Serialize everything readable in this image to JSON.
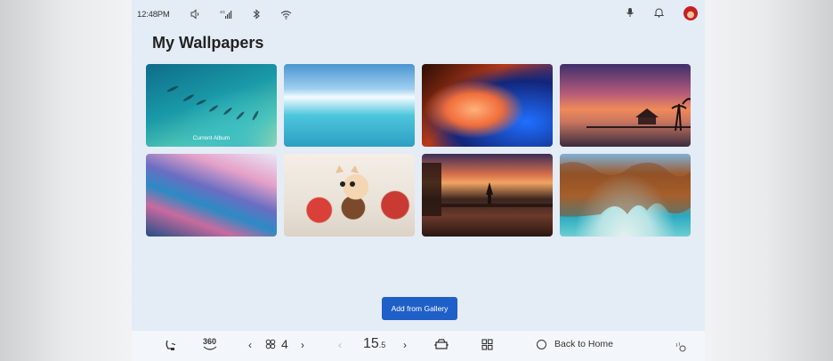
{
  "status": {
    "time": "12:48PM",
    "icons": [
      "volume-icon",
      "signal-icon",
      "bluetooth-icon",
      "wifi-icon"
    ],
    "right_icons": [
      "microphone-icon",
      "bell-icon",
      "avatar"
    ]
  },
  "page": {
    "title": "My Wallpapers"
  },
  "wallpapers": [
    {
      "name": "aerial-boats-lagoon",
      "caption": "Current Album"
    },
    {
      "name": "ocean-wave-horizon",
      "caption": ""
    },
    {
      "name": "abstract-orange-blue-swirl",
      "caption": ""
    },
    {
      "name": "sunset-overwater-hut",
      "caption": ""
    },
    {
      "name": "abstract-pink-blue-waves",
      "caption": ""
    },
    {
      "name": "kitten-in-flower-pot",
      "caption": ""
    },
    {
      "name": "pagoda-sunset-deck",
      "caption": ""
    },
    {
      "name": "sea-cave-beach",
      "caption": ""
    }
  ],
  "actions": {
    "add_from_gallery": "Add from Gallery"
  },
  "dock": {
    "view_360": "360",
    "fan_level": "4",
    "temperature_main": "15",
    "temperature_decimal": ".5",
    "back_to_home": "Back to Home"
  },
  "colors": {
    "accent": "#1f5fc8",
    "screen_bg": "#e4ecf6"
  }
}
